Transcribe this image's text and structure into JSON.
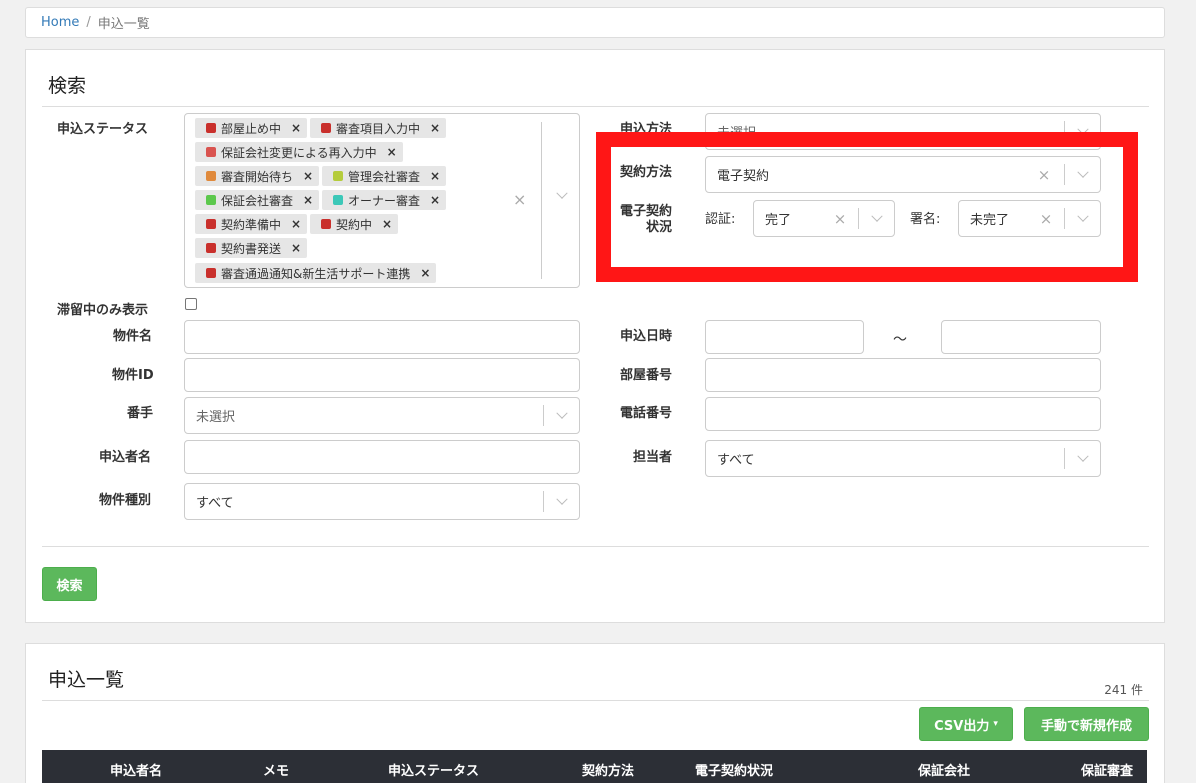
{
  "breadcrumb": {
    "home": "Home",
    "current": "申込一覧"
  },
  "search": {
    "title": "検索",
    "labels": {
      "status": "申込ステータス",
      "stagnant": "滞留中のみ表示",
      "property_name": "物件名",
      "property_id": "物件ID",
      "banchi": "番手",
      "applicant": "申込者名",
      "property_type": "物件種別",
      "apply_method": "申込方法",
      "contract_method": "契約方法",
      "econtract_status_l1": "電子契約",
      "econtract_status_l2": "状況",
      "auth": "認証:",
      "sign": "署名:",
      "apply_date": "申込日時",
      "room_no": "部屋番号",
      "phone": "電話番号",
      "staff": "担当者"
    },
    "status_chips": [
      {
        "label": "部屋止め中",
        "color": "#c9302c"
      },
      {
        "label": "審査項目入力中",
        "color": "#c9302c"
      },
      {
        "label": "保証会社変更による再入力中",
        "color": "#d9534f"
      },
      {
        "label": "審査開始待ち",
        "color": "#e08a3c"
      },
      {
        "label": "管理会社審査",
        "color": "#b5cc3c"
      },
      {
        "label": "保証会社審査",
        "color": "#5cc84c"
      },
      {
        "label": "オーナー審査",
        "color": "#3cc8b8"
      },
      {
        "label": "契約準備中",
        "color": "#c9302c"
      },
      {
        "label": "契約中",
        "color": "#c9302c"
      },
      {
        "label": "契約書発送",
        "color": "#c9302c"
      },
      {
        "label": "審査通過通知&新生活サポート連携",
        "color": "#c9302c"
      }
    ],
    "values": {
      "apply_method": "未選択",
      "contract_method": "電子契約",
      "auth": "完了",
      "sign": "未完了",
      "banchi": "未選択",
      "property_type": "すべて",
      "staff": "すべて",
      "tilde": "～"
    },
    "button": "検索"
  },
  "list": {
    "title": "申込一覧",
    "count": "241 件",
    "csv_button": "CSV出力",
    "new_button": "手動で新規作成",
    "columns": [
      "申込者名",
      "メモ",
      "申込ステータス",
      "契約方法",
      "電子契約状況",
      "保証会社",
      "保証審査"
    ]
  },
  "colors": {
    "accent_green": "#5cb85c",
    "highlight_red": "#ff1616",
    "table_header": "#2c2f36"
  }
}
